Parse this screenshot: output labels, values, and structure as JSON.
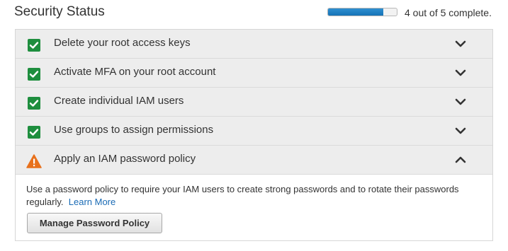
{
  "header": {
    "title": "Security Status",
    "progress_fraction": 0.8,
    "progress_text": "4 out of 5 complete."
  },
  "colors": {
    "accent": "#1573b6",
    "success": "#1e8e3e",
    "warning": "#e8711c",
    "link": "#1a6bb5"
  },
  "items": [
    {
      "label": "Delete your root access keys",
      "status": "complete",
      "icon": "check-icon",
      "expanded": false
    },
    {
      "label": "Activate MFA on your root account",
      "status": "complete",
      "icon": "check-icon",
      "expanded": false
    },
    {
      "label": "Create individual IAM users",
      "status": "complete",
      "icon": "check-icon",
      "expanded": false
    },
    {
      "label": "Use groups to assign permissions",
      "status": "complete",
      "icon": "check-icon",
      "expanded": false
    },
    {
      "label": "Apply an IAM password policy",
      "status": "warning",
      "icon": "warning-icon",
      "expanded": true
    }
  ],
  "detail": {
    "text": "Use a password policy to require your IAM users to create strong passwords and to rotate their passwords regularly.",
    "link_text": "Learn More",
    "button_label": "Manage Password Policy"
  }
}
